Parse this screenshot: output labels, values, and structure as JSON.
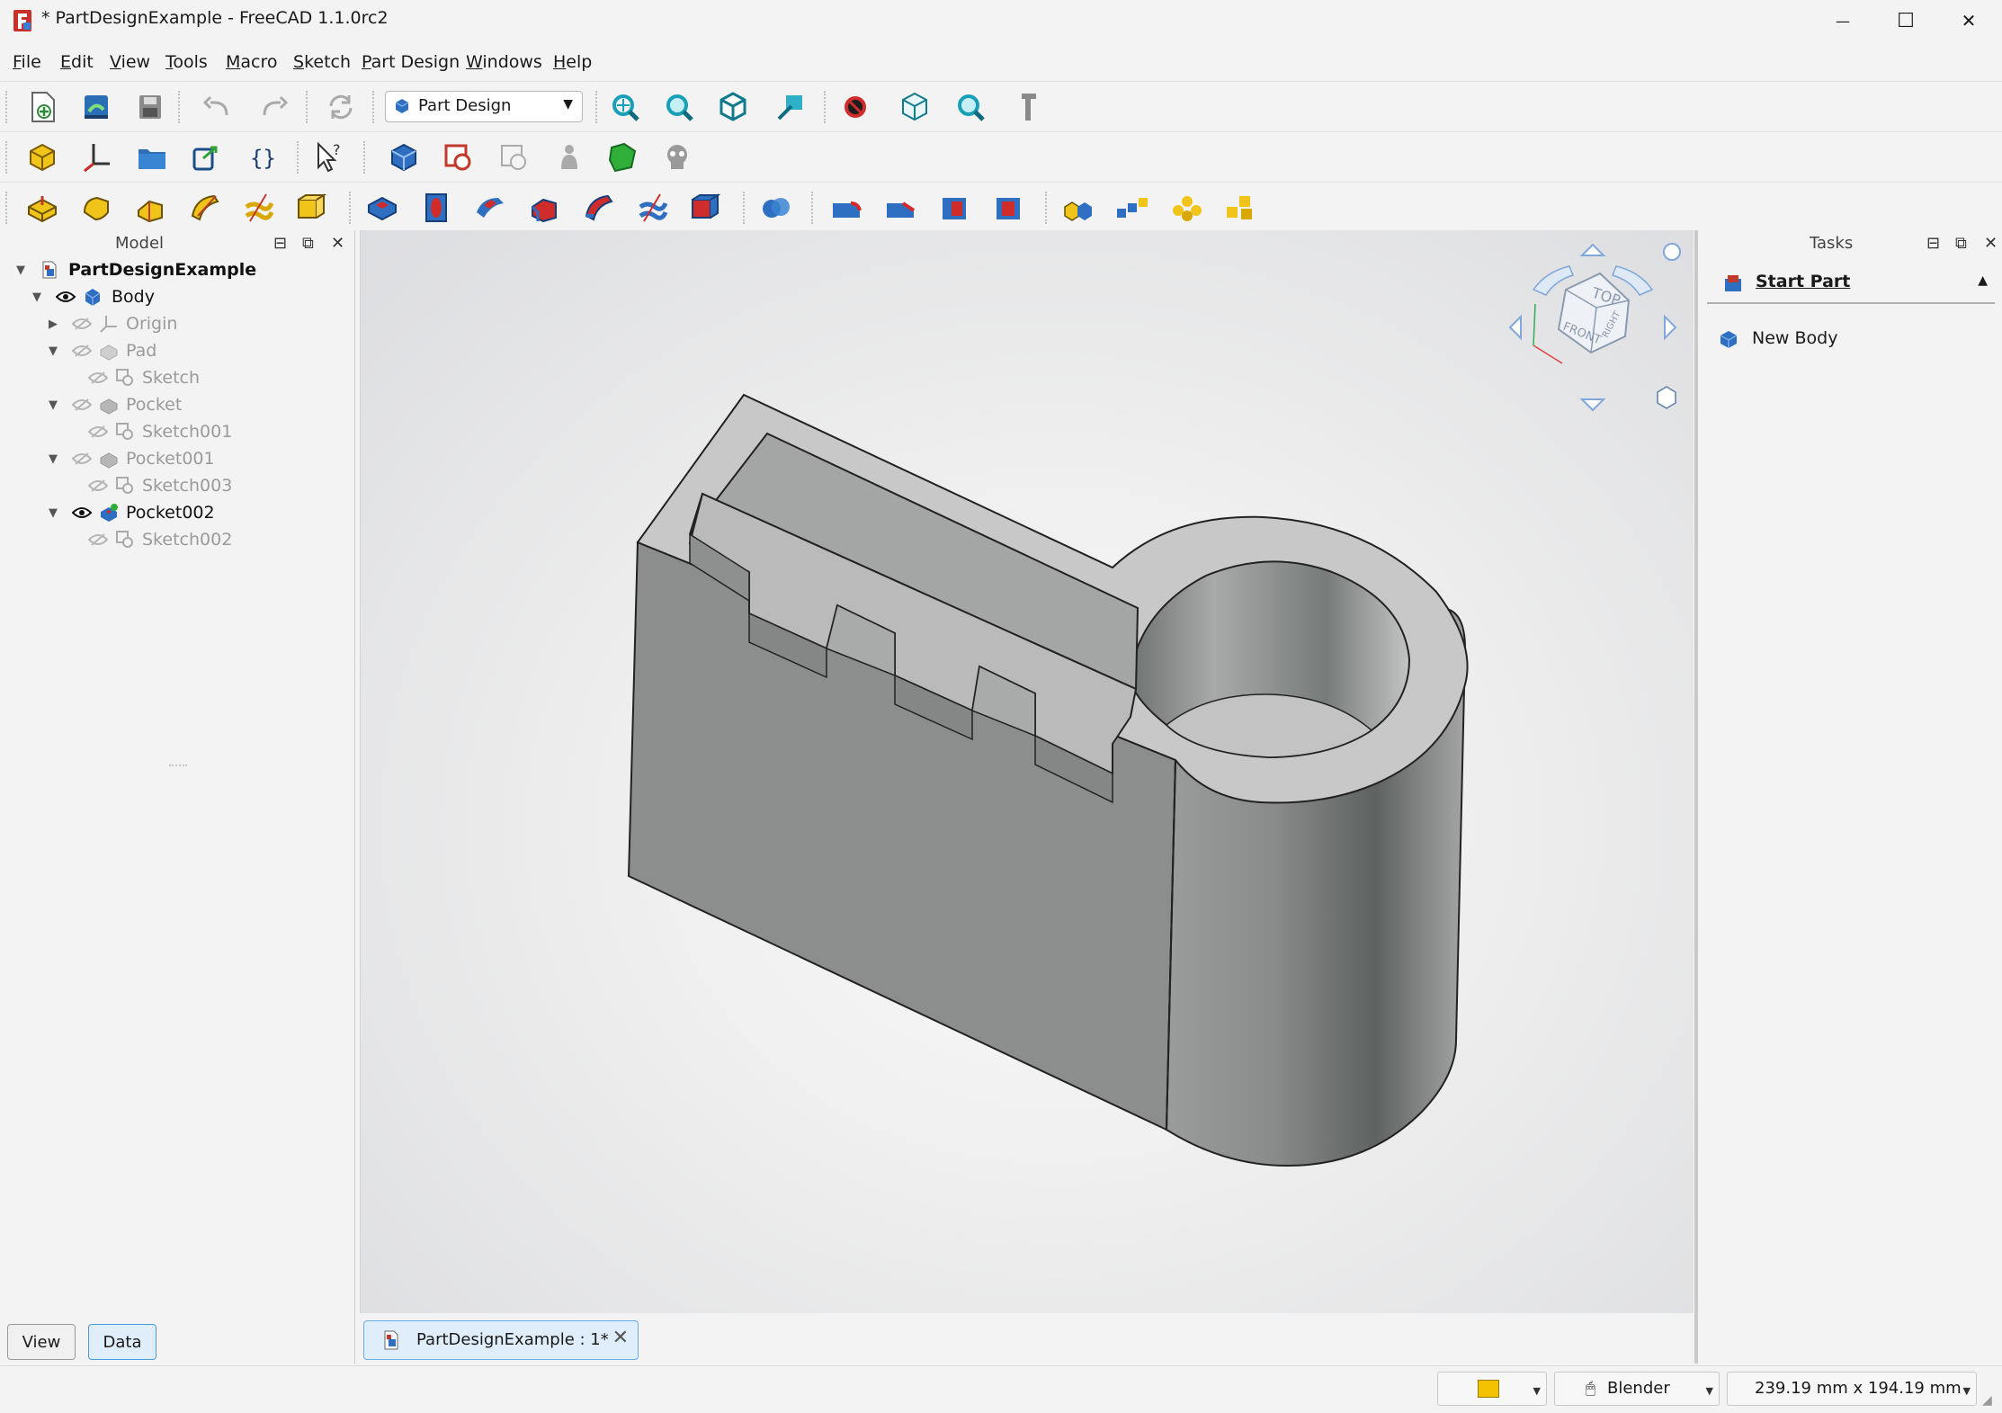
{
  "window": {
    "title": "* PartDesignExample - FreeCAD 1.1.0rc2",
    "minimize_glyph": "—",
    "maximize_glyph": "☐",
    "close_glyph": "✕"
  },
  "menu": [
    "File",
    "Edit",
    "View",
    "Tools",
    "Macro",
    "Sketch",
    "Part Design",
    "Windows",
    "Help"
  ],
  "toolbar": {
    "workbench": "Part Design",
    "row1_icons": [
      "new-document-icon",
      "open-document-icon",
      "save-document-icon",
      "undo-icon",
      "redo-icon",
      "refresh-icon",
      "fit-all-icon",
      "fit-selection-icon",
      "isometric-view-icon",
      "measure-distance-icon",
      "draw-style-icon",
      "std-views-icon",
      "zoom-icon",
      "measure-tool-icon"
    ],
    "row2_icons": [
      "create-part-icon",
      "create-datum-icon",
      "create-group-icon",
      "create-link-icon",
      "create-variable-set-icon",
      "whats-this-icon",
      "create-body-icon",
      "create-sketch-icon",
      "validate-sketch-icon",
      "shape-binder-icon",
      "subshape-binder-icon",
      "clone-icon"
    ],
    "row3_icons": [
      "pad-icon",
      "revolution-icon",
      "additive-loft-icon",
      "additive-pipe-icon",
      "additive-helix-icon",
      "additive-primitive-icon",
      "pocket-icon",
      "hole-icon",
      "groove-icon",
      "subtractive-loft-icon",
      "subtractive-pipe-icon",
      "subtractive-helix-icon",
      "subtractive-primitive-icon",
      "boolean-icon",
      "fillet-icon",
      "chamfer-icon",
      "draft-icon",
      "thickness-icon",
      "mirrored-icon",
      "linear-pattern-icon",
      "polar-pattern-icon",
      "multi-transform-icon"
    ]
  },
  "model_panel": {
    "title": "Model",
    "tree": [
      {
        "label": "PartDesignExample",
        "state": "document"
      },
      {
        "label": "Body",
        "state": "visible"
      },
      {
        "label": "Origin",
        "state": "hidden"
      },
      {
        "label": "Pad",
        "state": "hidden"
      },
      {
        "label": "Sketch",
        "state": "hidden"
      },
      {
        "label": "Pocket",
        "state": "hidden"
      },
      {
        "label": "Sketch001",
        "state": "hidden"
      },
      {
        "label": "Pocket001",
        "state": "hidden"
      },
      {
        "label": "Sketch003",
        "state": "hidden"
      },
      {
        "label": "Pocket002",
        "state": "visible"
      },
      {
        "label": "Sketch002",
        "state": "hidden"
      }
    ],
    "tabs": [
      "View",
      "Data"
    ],
    "active_tab": "Data"
  },
  "viewport": {
    "document_tab": "PartDesignExample : 1*",
    "navcube_faces": [
      "TOP",
      "FRONT",
      "RIGHT"
    ]
  },
  "tasks_panel": {
    "title": "Tasks",
    "section": "Start Part",
    "actions": [
      "New Body"
    ]
  },
  "statusbar": {
    "navigation_style": "Blender",
    "dimensions": "239.19 mm x 194.19 mm",
    "swatch_color": "#f2c200"
  },
  "colors": {
    "accent_blue": "#1f6fd0",
    "tab_highlight": "#dfeefa",
    "part_gray": "#8f9190"
  }
}
